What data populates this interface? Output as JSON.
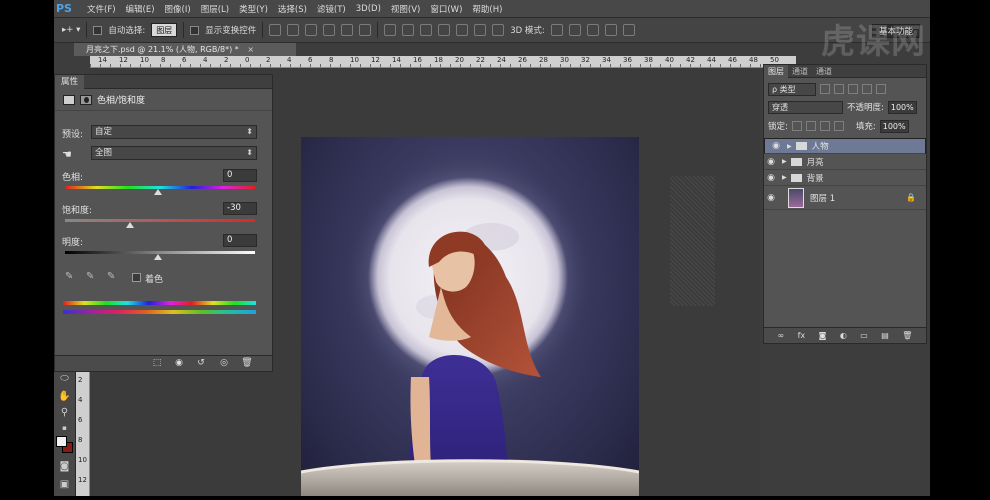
{
  "menubar": {
    "logo": "PS",
    "items": [
      "文件(F)",
      "编辑(E)",
      "图像(I)",
      "图层(L)",
      "类型(Y)",
      "选择(S)",
      "滤镜(T)",
      "3D(D)",
      "视图(V)",
      "窗口(W)",
      "帮助(H)"
    ]
  },
  "optbar": {
    "auto_select_label": "自动选择:",
    "auto_select_value": "图层",
    "show_transform_label": "显示变换控件",
    "mode_3d_label": "3D 模式:",
    "workspace": "基本功能"
  },
  "document": {
    "tab_title": "月亮之下.psd @ 21.1% (人物, RGB/8*) *",
    "close": "×",
    "ruler_h_ticks": [
      "14",
      "12",
      "10",
      "8",
      "6",
      "4",
      "2",
      "0",
      "2",
      "4",
      "6",
      "8",
      "10",
      "12",
      "14",
      "16",
      "18",
      "20",
      "22",
      "24",
      "26",
      "28",
      "30",
      "32",
      "34",
      "36",
      "38",
      "40",
      "42",
      "44",
      "46",
      "48",
      "50"
    ],
    "ruler_v_ticks": [
      "2",
      "4",
      "6",
      "8",
      "10",
      "12"
    ]
  },
  "properties": {
    "tab": "属性",
    "title": "色相/饱和度",
    "preset_label": "预设:",
    "preset_value": "自定",
    "channel_value": "全图",
    "hue_label": "色相:",
    "hue_value": "0",
    "saturation_label": "饱和度:",
    "saturation_value": "-30",
    "lightness_label": "明度:",
    "lightness_value": "0",
    "colorize_label": "着色"
  },
  "layers": {
    "tabs": [
      "图层",
      "通道",
      "通道"
    ],
    "filter_kind": "ρ 类型",
    "blend_mode": "穿透",
    "opacity_label": "不透明度:",
    "opacity_value": "100%",
    "lock_label": "锁定:",
    "fill_label": "填充:",
    "fill_value": "100%",
    "items": [
      {
        "name": "人物",
        "type": "group",
        "selected": true
      },
      {
        "name": "月亮",
        "type": "group",
        "selected": false
      },
      {
        "name": "背景",
        "type": "group",
        "selected": false
      },
      {
        "name": "图层 1",
        "type": "layer",
        "selected": false
      }
    ]
  },
  "watermark": "虎课网",
  "colors": {
    "fg_swatch": "#f2f2f2",
    "bg_swatch": "#8b1a14",
    "layer_selected": "#6e7a95"
  }
}
